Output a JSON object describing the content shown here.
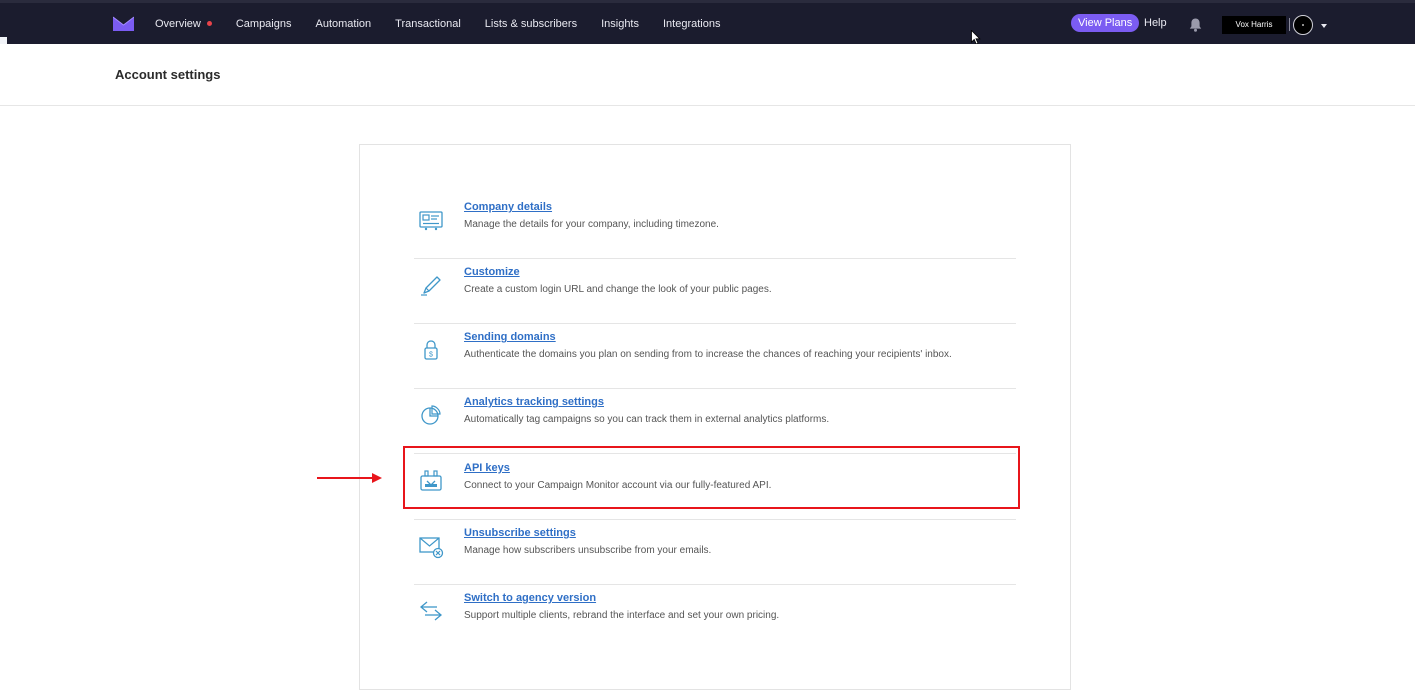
{
  "nav": {
    "items": [
      {
        "label": "Overview",
        "has_dot": true
      },
      {
        "label": "Campaigns"
      },
      {
        "label": "Automation"
      },
      {
        "label": "Transactional"
      },
      {
        "label": "Lists & subscribers"
      },
      {
        "label": "Insights"
      },
      {
        "label": "Integrations"
      }
    ],
    "view_plans": "View Plans",
    "help": "Help",
    "account_name": "Vox Harris"
  },
  "page": {
    "title": "Account settings"
  },
  "settings": [
    {
      "id": "company-details",
      "icon": "id-card-icon",
      "title": "Company details",
      "description": "Manage the details for your company, including timezone."
    },
    {
      "id": "customize",
      "icon": "pen-icon",
      "title": "Customize",
      "description": "Create a custom login URL and change the look of your public pages."
    },
    {
      "id": "sending-domains",
      "icon": "lock-icon",
      "title": "Sending domains",
      "description": "Authenticate the domains you plan on sending from to increase the chances of reaching your recipients' inbox."
    },
    {
      "id": "analytics-tracking",
      "icon": "pie-chart-icon",
      "title": "Analytics tracking settings",
      "description": "Automatically tag campaigns so you can track them in external analytics platforms."
    },
    {
      "id": "api-keys",
      "icon": "plug-icon",
      "title": "API keys",
      "description": "Connect to your Campaign Monitor account via our fully-featured API."
    },
    {
      "id": "unsubscribe-settings",
      "icon": "envelope-x-icon",
      "title": "Unsubscribe settings",
      "description": "Manage how subscribers unsubscribe from your emails."
    },
    {
      "id": "agency-version",
      "icon": "swap-arrows-icon",
      "title": "Switch to agency version",
      "description": "Support multiple clients, rebrand the interface and set your own pricing."
    }
  ],
  "colors": {
    "nav_bg": "#1b1c2e",
    "accent": "#7b5cf2",
    "link": "#2f6fc6",
    "icon": "#3f97c9",
    "annotation": "#e8151b"
  }
}
